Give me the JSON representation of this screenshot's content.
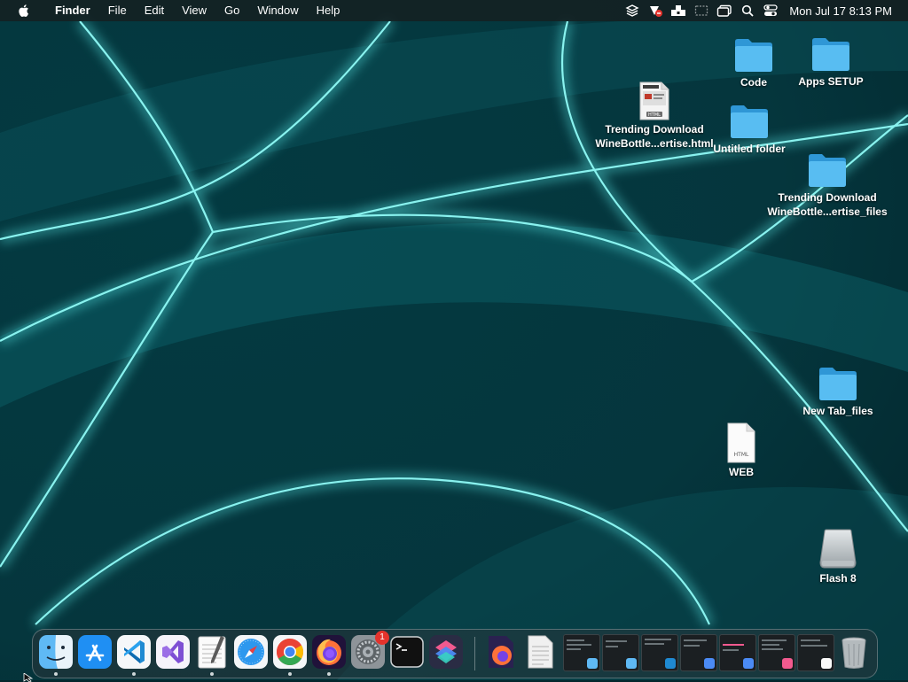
{
  "menubar": {
    "apple_icon": "apple-logo-icon",
    "app_name": "Finder",
    "menus": [
      "File",
      "Edit",
      "View",
      "Go",
      "Window",
      "Help"
    ],
    "status_icons": [
      "layers-icon",
      "shortcuts-status-icon",
      "notchmeister-icon",
      "screen-mirroring-icon",
      "window-icon",
      "search-icon",
      "control-center-icon"
    ],
    "clock": "Mon Jul 17  8:13 PM"
  },
  "desktop": {
    "items": [
      {
        "label": "Code",
        "icon": "folder-icon"
      },
      {
        "label": "Apps SETUP",
        "icon": "folder-icon"
      },
      {
        "label": "Trending Download\nWineBottle...ertise.html",
        "icon": "html-document-thumbnail-icon"
      },
      {
        "label": "Untitled folder",
        "icon": "folder-icon"
      },
      {
        "label": "Trending Download\nWineBottle...ertise_files",
        "icon": "folder-icon"
      },
      {
        "label": "New Tab_files",
        "icon": "folder-icon"
      },
      {
        "label": "WEB",
        "icon": "html-file-icon"
      },
      {
        "label": "Flash 8",
        "icon": "external-drive-icon"
      }
    ]
  },
  "dock": {
    "apps": [
      {
        "name": "Finder",
        "icon": "finder-icon",
        "running": true
      },
      {
        "name": "App Store",
        "icon": "app-store-icon",
        "running": false
      },
      {
        "name": "Visual Studio Code",
        "icon": "vscode-icon",
        "running": true
      },
      {
        "name": "Visual Studio",
        "icon": "visual-studio-icon",
        "running": false
      },
      {
        "name": "TextEdit",
        "icon": "textedit-icon",
        "running": true
      },
      {
        "name": "Safari",
        "icon": "safari-icon",
        "running": false
      },
      {
        "name": "Google Chrome",
        "icon": "chrome-icon",
        "running": true
      },
      {
        "name": "Firefox",
        "icon": "firefox-icon",
        "running": true
      },
      {
        "name": "System Settings",
        "icon": "settings-icon",
        "running": false,
        "badge": "1"
      },
      {
        "name": "Terminal",
        "icon": "terminal-icon",
        "running": false
      },
      {
        "name": "Shortcuts",
        "icon": "shortcuts-icon",
        "running": false
      }
    ],
    "recent": [
      "firefox-document-icon",
      "generic-document-icon"
    ],
    "minimized_windows": 7,
    "trash_icon": "trash-icon"
  },
  "colors": {
    "wallpaper_base": "#04262c",
    "wallpaper_glow": "#5ff0ee",
    "folder": "#4fb5ee",
    "menubar": "#161e20"
  }
}
